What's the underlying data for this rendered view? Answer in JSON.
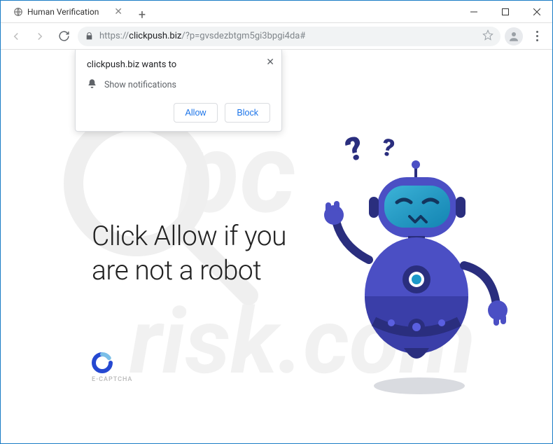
{
  "window": {
    "tab_title": "Human Verification",
    "url_scheme": "https://",
    "url_host": "clickpush.biz",
    "url_path": "/?p=gvsdezbtgm5gi3bpgi4da#"
  },
  "permission": {
    "origin_wants_to": "clickpush.biz wants to",
    "request_text": "Show notifications",
    "allow_label": "Allow",
    "block_label": "Block"
  },
  "page": {
    "headline": "Click Allow if you are not a robot",
    "captcha_brand": "E-CAPTCHA"
  },
  "colors": {
    "robot_primary": "#4b4fc4",
    "robot_dark": "#2a2e7e",
    "robot_accent": "#1b98c9",
    "accent_blue": "#1a73e8"
  }
}
